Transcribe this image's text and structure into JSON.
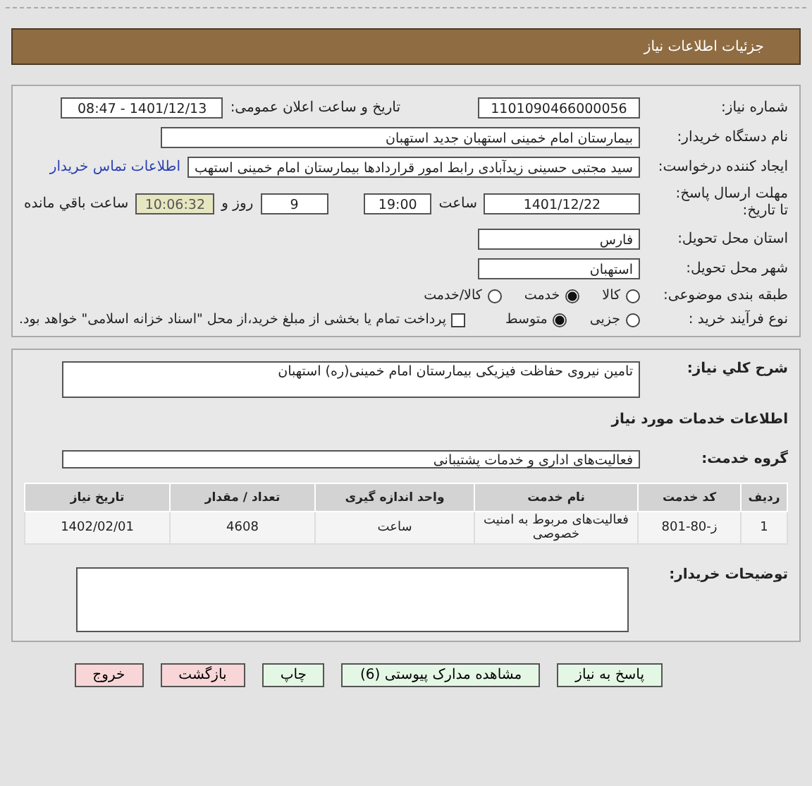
{
  "header": {
    "title": "جزئیات اطلاعات نیاز"
  },
  "need_number": {
    "label": "شماره نیاز:",
    "value": "1101090466000056"
  },
  "announce": {
    "label": "تاریخ و ساعت اعلان عمومی:",
    "value": "1401/12/13 - 08:47"
  },
  "buyer": {
    "label": "نام دستگاه خریدار:",
    "value": "بیمارستان امام خمینی استهبان جدید استهبان"
  },
  "requester": {
    "label": "ایجاد کننده درخواست:",
    "value": "سید مجتبی حسینی زیدآبادی رابط امور قراردادها بیمارستان امام خمینی استهب",
    "link": "اطلاعات تماس خریدار"
  },
  "deadline": {
    "label": "مهلت ارسال پاسخ: تا تاریخ:",
    "date": "1401/12/22",
    "time_label": "ساعت",
    "time": "19:00",
    "days": "9",
    "days_label": "روز و",
    "remaining": "10:06:32",
    "remaining_label": "ساعت باقي مانده"
  },
  "province": {
    "label": "استان محل تحویل:",
    "value": "فارس"
  },
  "city": {
    "label": "شهر محل تحویل:",
    "value": "استهبان"
  },
  "category": {
    "label": "طبقه بندی موضوعی:",
    "options": [
      {
        "label": "کالا",
        "selected": false
      },
      {
        "label": "خدمت",
        "selected": true
      },
      {
        "label": "کالا/خدمت",
        "selected": false
      }
    ]
  },
  "process": {
    "label": "نوع فرآیند خرید :",
    "options": [
      {
        "label": "جزیی",
        "selected": false
      },
      {
        "label": "متوسط",
        "selected": true
      }
    ],
    "payment": {
      "checked": false,
      "label": "پرداخت تمام یا بخشی از مبلغ خرید،از محل \"اسناد خزانه اسلامی\" خواهد بود."
    }
  },
  "description": {
    "label": "شرح کلي نياز:",
    "value": "تامین نیروی حفاظت فیزیکی بیمارستان امام خمینی(ره) استهبان"
  },
  "services_title": "اطلاعات خدمات مورد نیاز",
  "service_group": {
    "label": "گروه خدمت:",
    "value": "فعالیت‌های اداری و خدمات پشتیبانی"
  },
  "table": {
    "columns": [
      "ردیف",
      "کد خدمت",
      "نام خدمت",
      "واحد اندازه گیری",
      "تعداد / مقدار",
      "تاریخ نیاز"
    ],
    "rows": [
      [
        "1",
        "ز-80-801",
        "فعالیت‌های مربوط به امنیت خصوصی",
        "ساعت",
        "4608",
        "1402/02/01"
      ]
    ]
  },
  "buyer_notes": {
    "label": "توضیحات خریدار:"
  },
  "buttons": [
    {
      "label": "پاسخ به نیاز",
      "kind": "action"
    },
    {
      "label": "مشاهده مدارک پیوستی (6)",
      "kind": "action"
    },
    {
      "label": "چاپ",
      "kind": "action"
    },
    {
      "label": "بازگشت",
      "kind": "exit"
    },
    {
      "label": "خروج",
      "kind": "exit"
    }
  ]
}
